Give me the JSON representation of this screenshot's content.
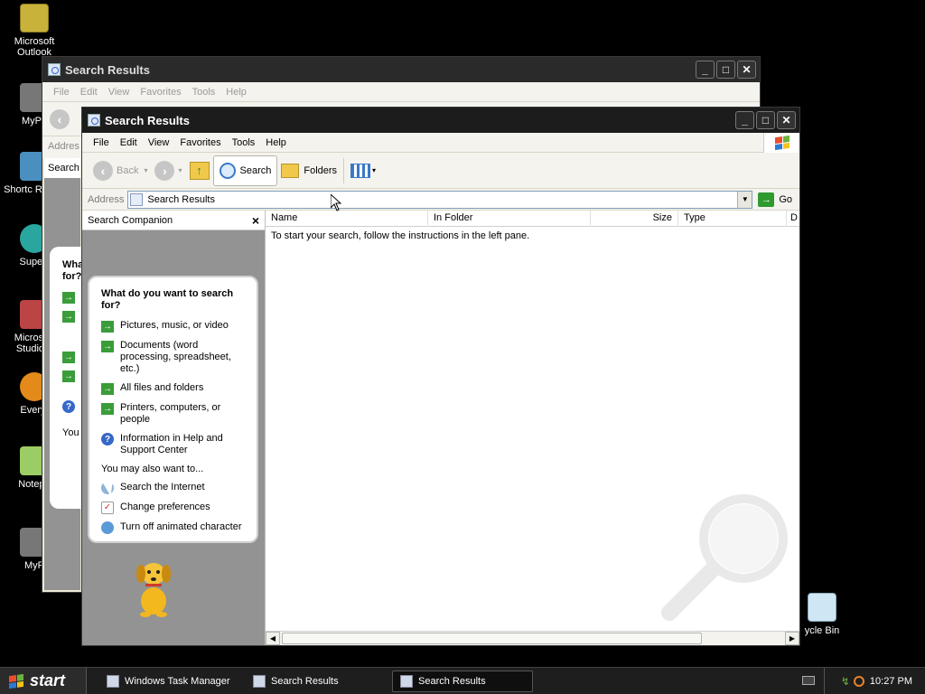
{
  "desktop": {
    "icons": [
      {
        "label": "Microsoft Outlook",
        "icon": "outlook-icon"
      },
      {
        "label": "MyPa",
        "icon": "network-places-icon"
      },
      {
        "label": "Shortc Recycl",
        "icon": "shortcut-recycle-icon"
      },
      {
        "label": "Superr",
        "icon": "globe-icon"
      },
      {
        "label": "Microsoft Studio 2",
        "icon": "visual-studio-icon"
      },
      {
        "label": "Everyt",
        "icon": "everything-search-icon"
      },
      {
        "label": "Notepa",
        "icon": "notepad-plus-icon"
      },
      {
        "label": "MyP",
        "icon": "network-places-icon"
      },
      {
        "label": "ycle Bin",
        "icon": "recycle-bin-icon"
      }
    ]
  },
  "back_window": {
    "title": "Search Results",
    "menu": [
      "File",
      "Edit",
      "View",
      "Favorites",
      "Tools",
      "Help"
    ],
    "address_label": "Addres",
    "side_label": "Search",
    "bubble_title": "Wha for?",
    "also_label": "You"
  },
  "front_window": {
    "title": "Search Results",
    "menu": [
      "File",
      "Edit",
      "View",
      "Favorites",
      "Tools",
      "Help"
    ],
    "toolbar": {
      "back": "Back",
      "search": "Search",
      "folders": "Folders"
    },
    "address": {
      "label": "Address",
      "value": "Search Results",
      "go": "Go"
    },
    "companion": {
      "title": "Search Companion",
      "close": "×",
      "question": "What do you want to search for?",
      "options": [
        "Pictures, music, or video",
        "Documents (word processing, spreadsheet, etc.)",
        "All files and folders",
        "Printers, computers, or people",
        "Information in Help and Support Center"
      ],
      "also_label": "You may also want to...",
      "also_items": [
        "Search the Internet",
        "Change preferences",
        "Turn off animated character"
      ]
    },
    "columns": [
      "Name",
      "In Folder",
      "Size",
      "Type",
      "D"
    ],
    "message": "To start your search, follow the instructions in the left pane."
  },
  "taskbar": {
    "start": "start",
    "tasks": [
      "Windows Task Manager",
      "Search Results",
      "Search Results"
    ],
    "clock": "10:27 PM"
  },
  "colors": {
    "green_arrow": "#3a9d3a",
    "help_blue": "#3568c8",
    "companion_bg": "#939393"
  }
}
